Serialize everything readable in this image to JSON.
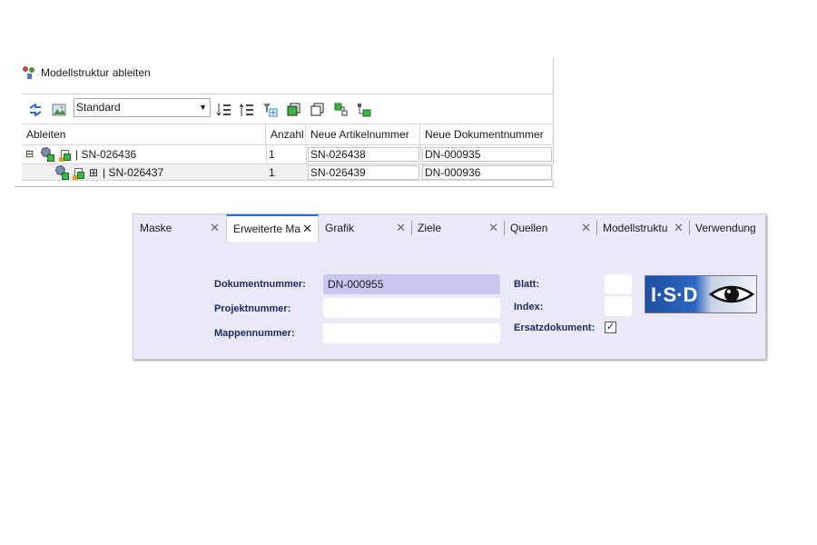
{
  "panel1": {
    "title": "Modellstruktur ableiten",
    "combo": {
      "value": "Standard"
    },
    "toolbar_icons": [
      "refresh-icon",
      "image-icon",
      "sort-down-icon",
      "sort-up-icon",
      "filter-add-icon",
      "copy-icon",
      "copy-outline-icon",
      "node-icon",
      "tree-node-icon"
    ],
    "columns": [
      "Ableiten",
      "Anzahl",
      "Neue Artikelnummer",
      "Neue Dokumentnummer"
    ],
    "rows": [
      {
        "expander": "⊟",
        "name": "| SN-026436",
        "anzahl": "1",
        "artikel": "SN-026438",
        "dokument": "DN-000935"
      },
      {
        "expander": "",
        "grid_symbol": "⊞",
        "name": "| SN-026437",
        "anzahl": "1",
        "artikel": "SN-026439",
        "dokument": "DN-000936"
      }
    ]
  },
  "panel2": {
    "tabs": [
      {
        "label": "Maske",
        "close": "✕"
      },
      {
        "label": "Erweiterte Ma",
        "close": "✕"
      },
      {
        "label": "Grafik",
        "close": "✕"
      },
      {
        "label": "Ziele",
        "close": "✕"
      },
      {
        "label": "Quellen",
        "close": "✕"
      },
      {
        "label": "Modellstruktu",
        "close": "✕"
      },
      {
        "label": "Verwendung",
        "close": ""
      }
    ],
    "fields": {
      "dokumentnummer": {
        "label": "Dokumentnummer:",
        "value": "DN-000955"
      },
      "projektnummer": {
        "label": "Projektnummer:",
        "value": ""
      },
      "mappennummer": {
        "label": "Mappennummer:",
        "value": ""
      },
      "blatt": {
        "label": "Blatt:",
        "value": ""
      },
      "index": {
        "label": "Index:",
        "value": ""
      },
      "ersatzdokument": {
        "label": "Ersatzdokument:",
        "checked": true,
        "mark": "✓"
      }
    },
    "logo": {
      "text": "I·S·D"
    }
  },
  "colors": {
    "accent": "#2b6fd6",
    "form_bg": "#e9e9f7",
    "selected_field": "#c7c7ef",
    "label": "#1c2a5c",
    "logo_blue": "#1f4fa0"
  }
}
